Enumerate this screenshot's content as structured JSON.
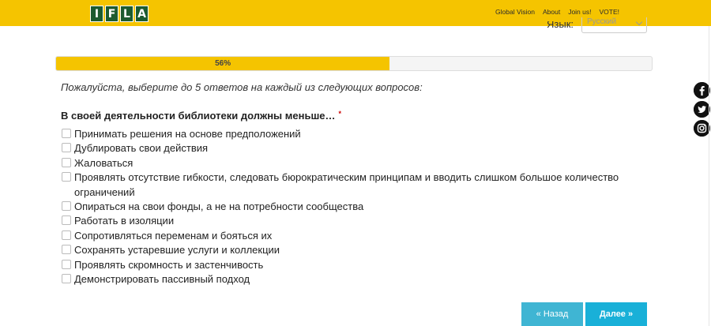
{
  "header": {
    "logo_letters": [
      "I",
      "F",
      "L",
      "A"
    ],
    "nav": [
      "Global Vision",
      "About",
      "Join us!",
      "VOTE!"
    ],
    "bg_color": "#f5c400"
  },
  "language": {
    "label": "Язык:",
    "selected": "Русский"
  },
  "progress": {
    "percent": 56,
    "label": "56%"
  },
  "instructions": "Пожалуйста, выберите до 5 ответов на каждый из следующих вопросов:",
  "question": {
    "title": "В своей деятельности библиотеки должны меньше…",
    "required_mark": "*",
    "options": [
      "Принимать решения на основе предположений",
      "Дублировать свои действия",
      "Жаловаться",
      "Проявлять отсутствие гибкости, следовать бюрократическим принципам и вводить слишком большое количество ограничений",
      "Опираться на свои фонды, а не на потребности сообщества",
      "Работать в изоляции",
      "Сопротивляться переменам и бояться их",
      "Сохранять устаревшие услуги и коллекции",
      "Проявлять скромность и застенчивость",
      "Демонстрировать пассивный подход"
    ]
  },
  "buttons": {
    "back": "« Назад",
    "next": "Далее »"
  },
  "social": {
    "icons": [
      "facebook-icon",
      "twitter-icon",
      "instagram-icon"
    ]
  }
}
